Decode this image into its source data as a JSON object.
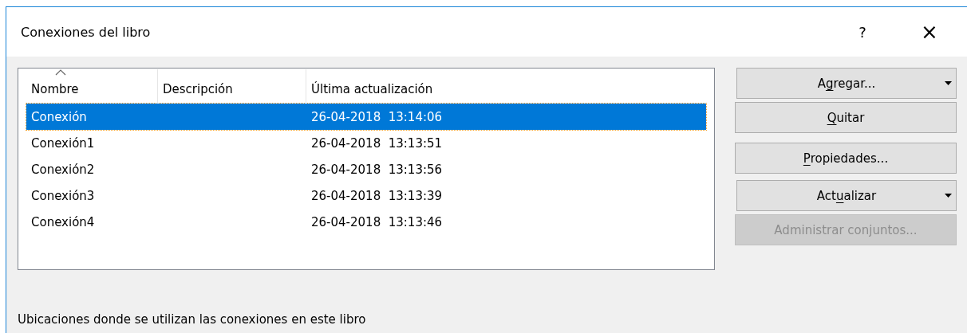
{
  "window": {
    "title": "Conexiones del libro",
    "help": "?",
    "close": "×"
  },
  "table": {
    "columns": [
      {
        "label": "Nombre",
        "sorted": true
      },
      {
        "label": "Descripción",
        "sorted": false
      },
      {
        "label": "Última actualización",
        "sorted": false
      }
    ],
    "rows": [
      {
        "name": "Conexión",
        "updated": "26-04-2018  13:14:06",
        "selected": true
      },
      {
        "name": "Conexión1",
        "updated": "26-04-2018  13:13:51",
        "selected": false
      },
      {
        "name": "Conexión2",
        "updated": "26-04-2018  13:13:56",
        "selected": false
      },
      {
        "name": "Conexión3",
        "updated": "26-04-2018  13:13:39",
        "selected": false
      },
      {
        "name": "Conexión4",
        "updated": "26-04-2018  13:13:46",
        "selected": false
      }
    ]
  },
  "buttons": [
    {
      "label_parts": [
        {
          "text": "A",
          "underlined": false
        },
        {
          "text": "g",
          "underlined": true
        },
        {
          "text": "regar...",
          "underlined": false
        }
      ],
      "menu": true,
      "disabled": false
    },
    {
      "label_parts": [
        {
          "text": "Q",
          "underlined": true
        },
        {
          "text": "uitar",
          "underlined": false
        }
      ],
      "menu": false,
      "disabled": false
    },
    {
      "label_parts": [
        {
          "text": "P",
          "underlined": true
        },
        {
          "text": "ropiedades...",
          "underlined": false
        }
      ],
      "menu": false,
      "disabled": false
    },
    {
      "label_parts": [
        {
          "text": "Act",
          "underlined": false
        },
        {
          "text": "u",
          "underlined": true
        },
        {
          "text": "alizar",
          "underlined": false
        }
      ],
      "menu": true,
      "disabled": false
    },
    {
      "label_parts": [
        {
          "text": "Administrar conjuntos...",
          "underlined": false
        }
      ],
      "menu": false,
      "disabled": true
    }
  ],
  "locations_label": "Ubicaciones donde se utilizan las conexiones en este libro"
}
